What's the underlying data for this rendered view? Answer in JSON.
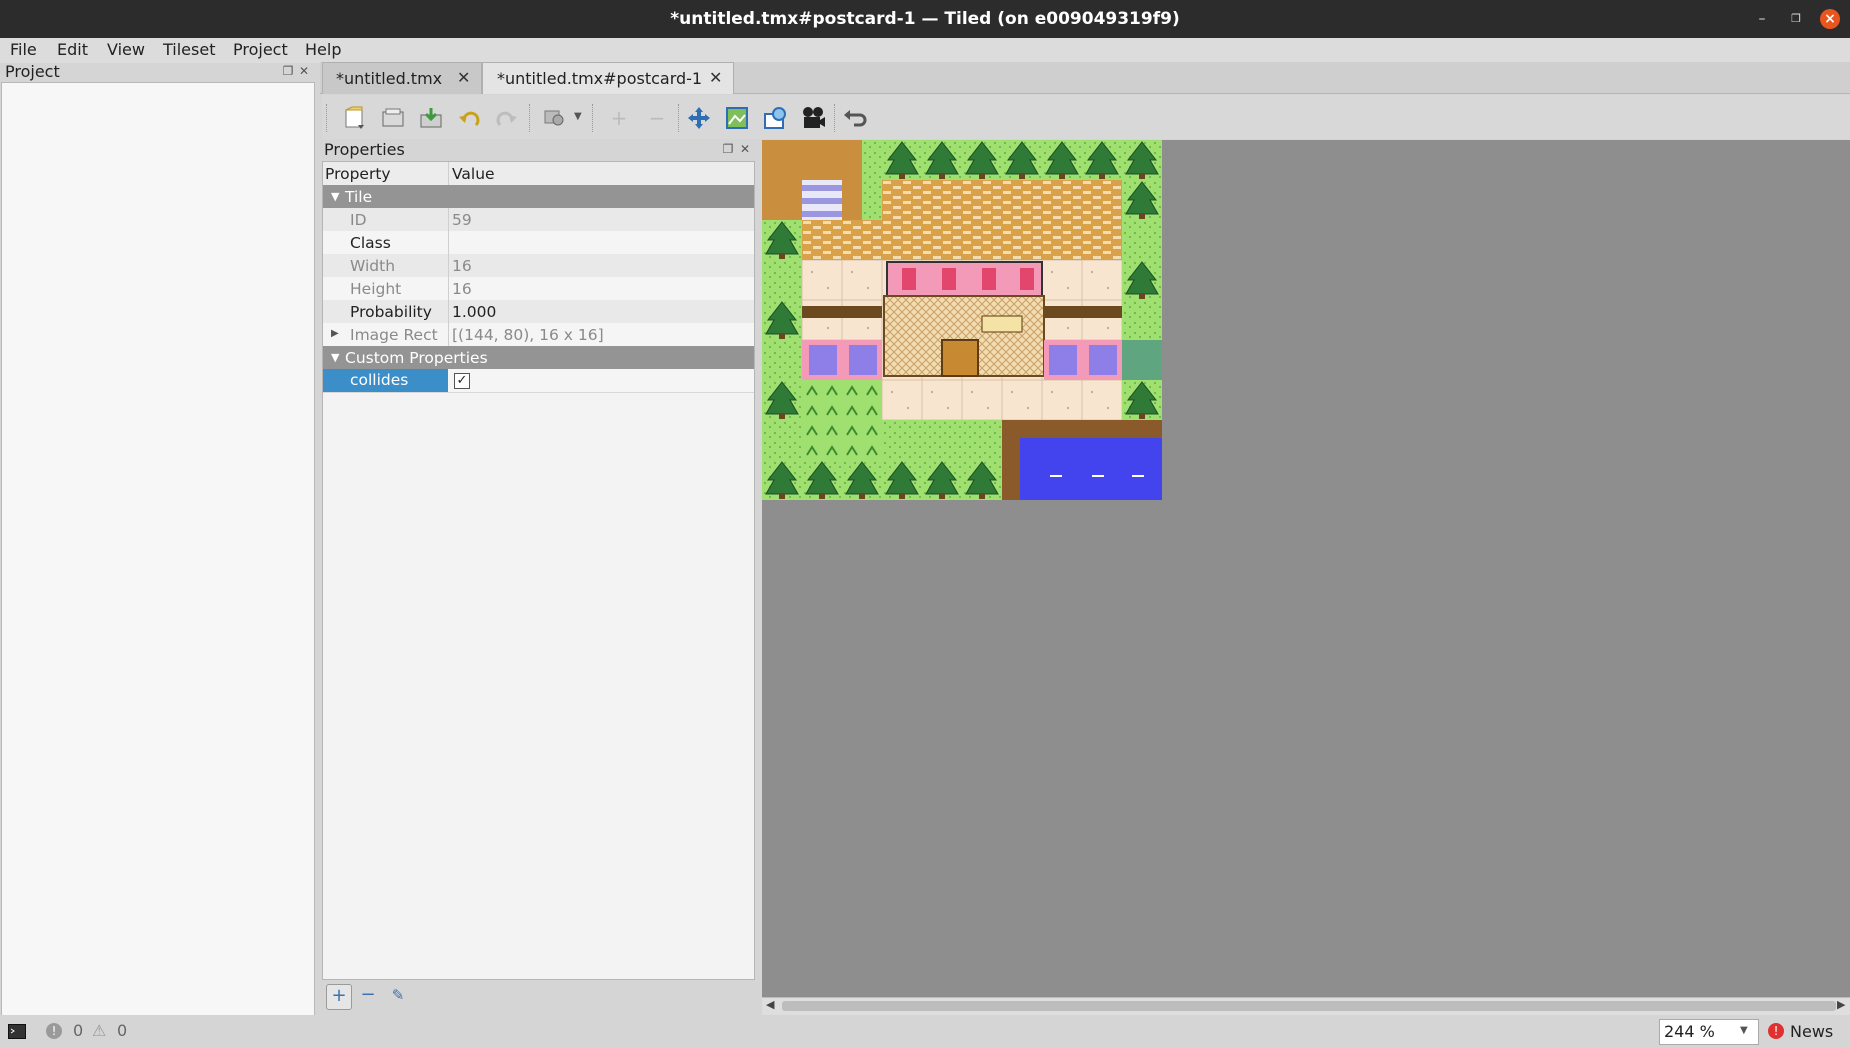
{
  "window": {
    "title": "*untitled.tmx#postcard-1 — Tiled (on e009049319f9)"
  },
  "menu": [
    "File",
    "Edit",
    "View",
    "Tileset",
    "Project",
    "Help"
  ],
  "project_panel": {
    "title": "Project"
  },
  "tabs": [
    {
      "label": "*untitled.tmx",
      "active": false
    },
    {
      "label": "*untitled.tmx#postcard-1",
      "active": true
    }
  ],
  "toolbar": [
    "new-tileset-icon",
    "open-icon",
    "save-icon",
    "undo-icon",
    "redo-icon",
    "tileset-settings-icon",
    "dropdown-icon",
    "add-icon",
    "remove-icon",
    "move-icon",
    "collision-editor-icon",
    "terrain-icon",
    "animation-icon",
    "back-icon"
  ],
  "properties": {
    "title": "Properties",
    "col_property": "Property",
    "col_value": "Value",
    "group_tile": "Tile",
    "rows": [
      {
        "key": "ID",
        "value": "59",
        "dim": true
      },
      {
        "key": "Class",
        "value": "",
        "dim": false
      },
      {
        "key": "Width",
        "value": "16",
        "dim": true
      },
      {
        "key": "Height",
        "value": "16",
        "dim": true
      },
      {
        "key": "Probability",
        "value": "1.000",
        "dim": false
      },
      {
        "key": "Image Rect",
        "value": "[(144, 80), 16 x 16]",
        "dim": true
      }
    ],
    "group_custom": "Custom Properties",
    "custom": {
      "key": "collides",
      "checked": true,
      "check_glyph": "✓"
    }
  },
  "status": {
    "errors": "0",
    "warnings": "0",
    "zoom": "244 %",
    "news": "News"
  },
  "colors": {
    "accent": "#3c8ec9",
    "canvas": "#8e8e8e",
    "titlebar": "#2c2c2c"
  }
}
